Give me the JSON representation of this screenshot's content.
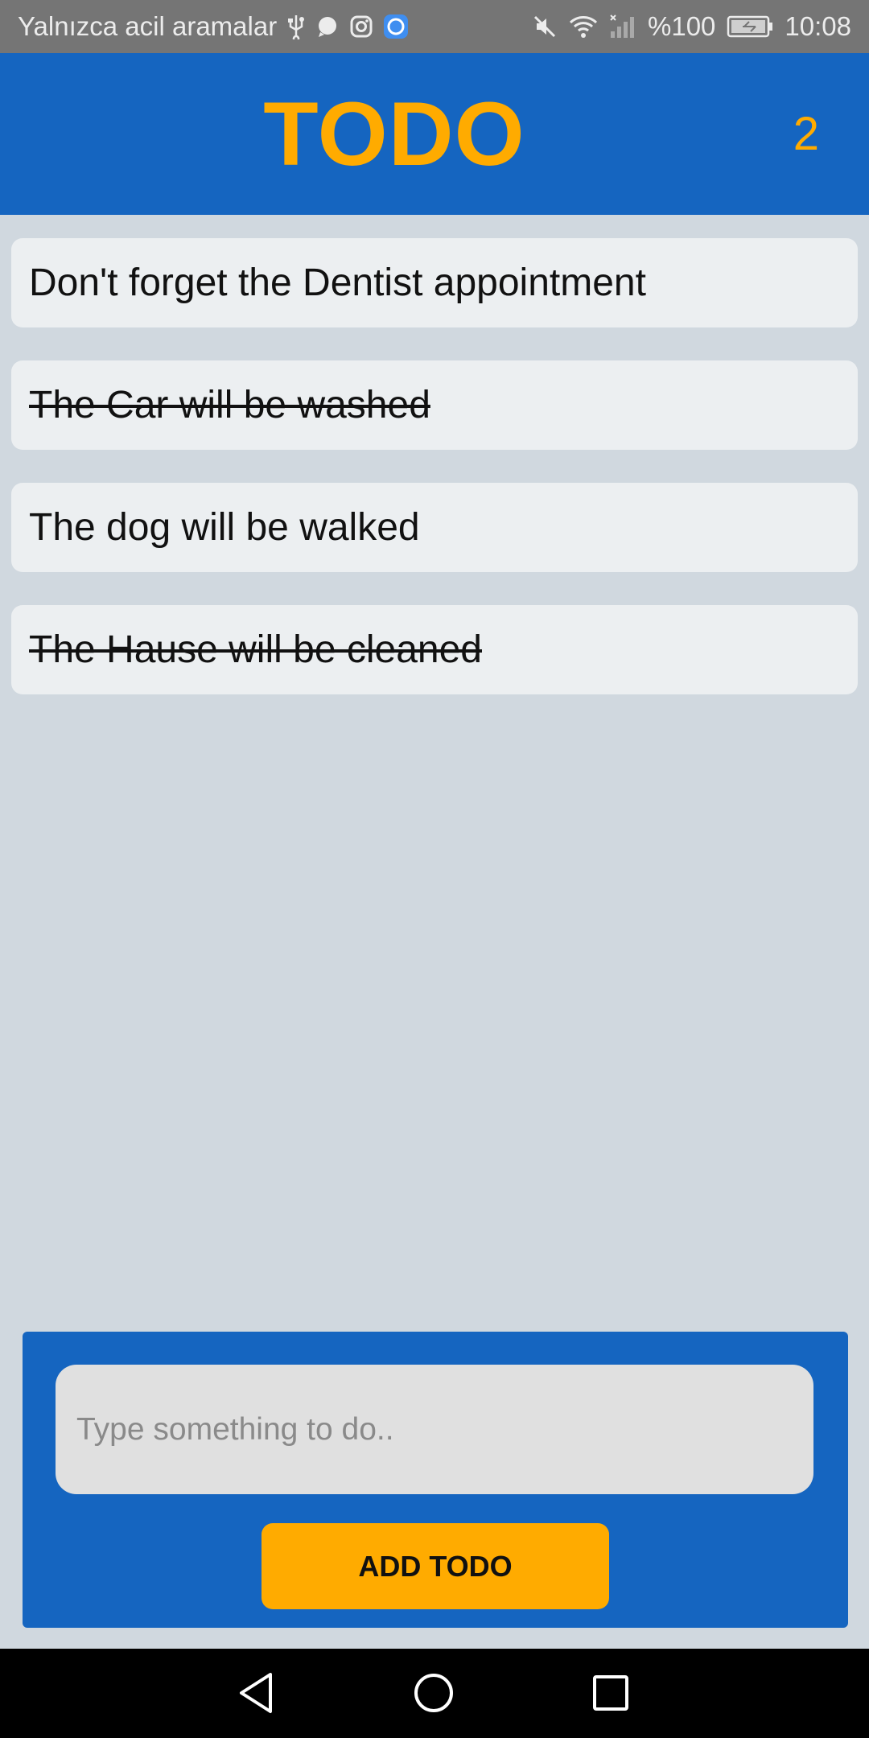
{
  "status_bar": {
    "carrier_text": "Yalnızca acil aramalar",
    "battery": "%100",
    "time": "10:08",
    "icons_left": [
      "usb-icon",
      "message-icon",
      "instagram-icon",
      "app-icon"
    ],
    "icons_right": [
      "mute-icon",
      "wifi-icon",
      "signal-icon",
      "battery-icon"
    ]
  },
  "header": {
    "title": "TODO",
    "count": "2",
    "title_color": "#ffab00",
    "background": "#1565c0"
  },
  "todos": [
    {
      "text": "Don't forget the Dentist appointment",
      "done": false
    },
    {
      "text": "The Car will be washed",
      "done": true
    },
    {
      "text": "The dog will be walked",
      "done": false
    },
    {
      "text": "The Hause will be cleaned",
      "done": true
    }
  ],
  "add_form": {
    "input_value": "",
    "input_placeholder": "Type something to do..",
    "button_label": "ADD TODO",
    "button_color": "#ffab00"
  },
  "nav_bar": {
    "buttons": [
      "back-icon",
      "home-icon",
      "recents-icon"
    ]
  }
}
